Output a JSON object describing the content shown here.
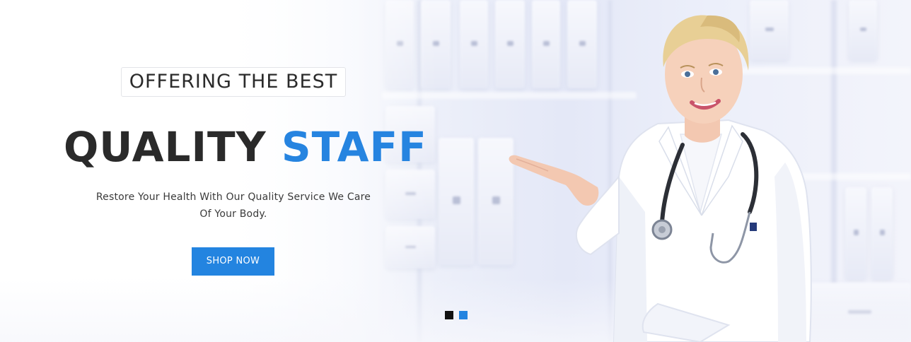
{
  "hero": {
    "eyebrow": "OFFERING THE BEST",
    "headline_main": "QUALITY",
    "headline_accent": "STAFF",
    "subtext_line1": "Restore Your Health With Our Quality Service We Care",
    "subtext_line2": "Of Your Body.",
    "cta_label": "SHOP NOW"
  },
  "slider": {
    "slide_count": 2,
    "active_slide": 1
  },
  "colors": {
    "accent": "#2384e0",
    "headline": "#2a2a2a",
    "active_dot": "#111111"
  },
  "image": {
    "icon": "doctor-illustration"
  }
}
